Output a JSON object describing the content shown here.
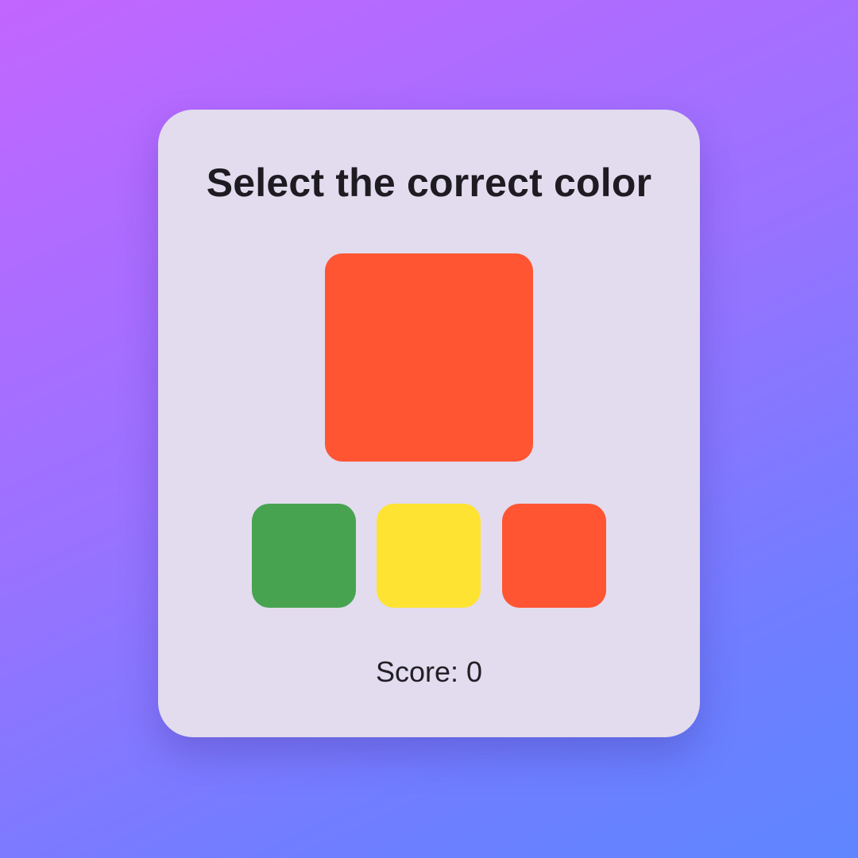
{
  "game": {
    "title": "Select the correct color",
    "target_color": "#ff5533",
    "options": [
      {
        "name": "green",
        "color": "#47a34f"
      },
      {
        "name": "yellow",
        "color": "#ffe332"
      },
      {
        "name": "orange-red",
        "color": "#ff5533"
      }
    ],
    "score_label": "Score:",
    "score_value": 0,
    "score_text": "Score: 0"
  }
}
